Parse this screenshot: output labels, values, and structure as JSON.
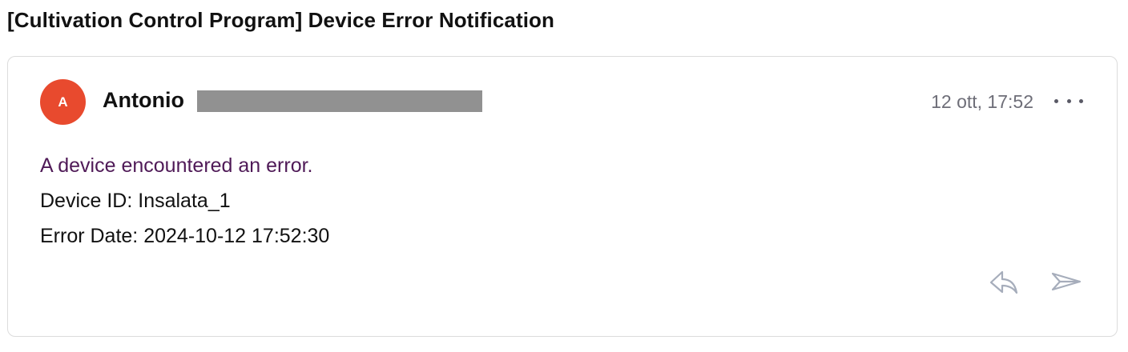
{
  "subject": "[Cultivation Control Program] Device Error Notification",
  "sender": {
    "avatar_letter": "A",
    "avatar_color": "#e84a2e",
    "name": "Antonio"
  },
  "timestamp": "12 ott, 17:52",
  "body": {
    "line1": "A device encountered an error.",
    "line2": "Device ID: Insalata_1",
    "line3": "Error Date: 2024-10-12 17:52:30"
  },
  "icons": {
    "more": "more-options-icon",
    "reply": "reply-icon",
    "forward": "forward-icon"
  },
  "colors": {
    "first_line": "#4f1a57",
    "muted": "#6e6e78"
  }
}
